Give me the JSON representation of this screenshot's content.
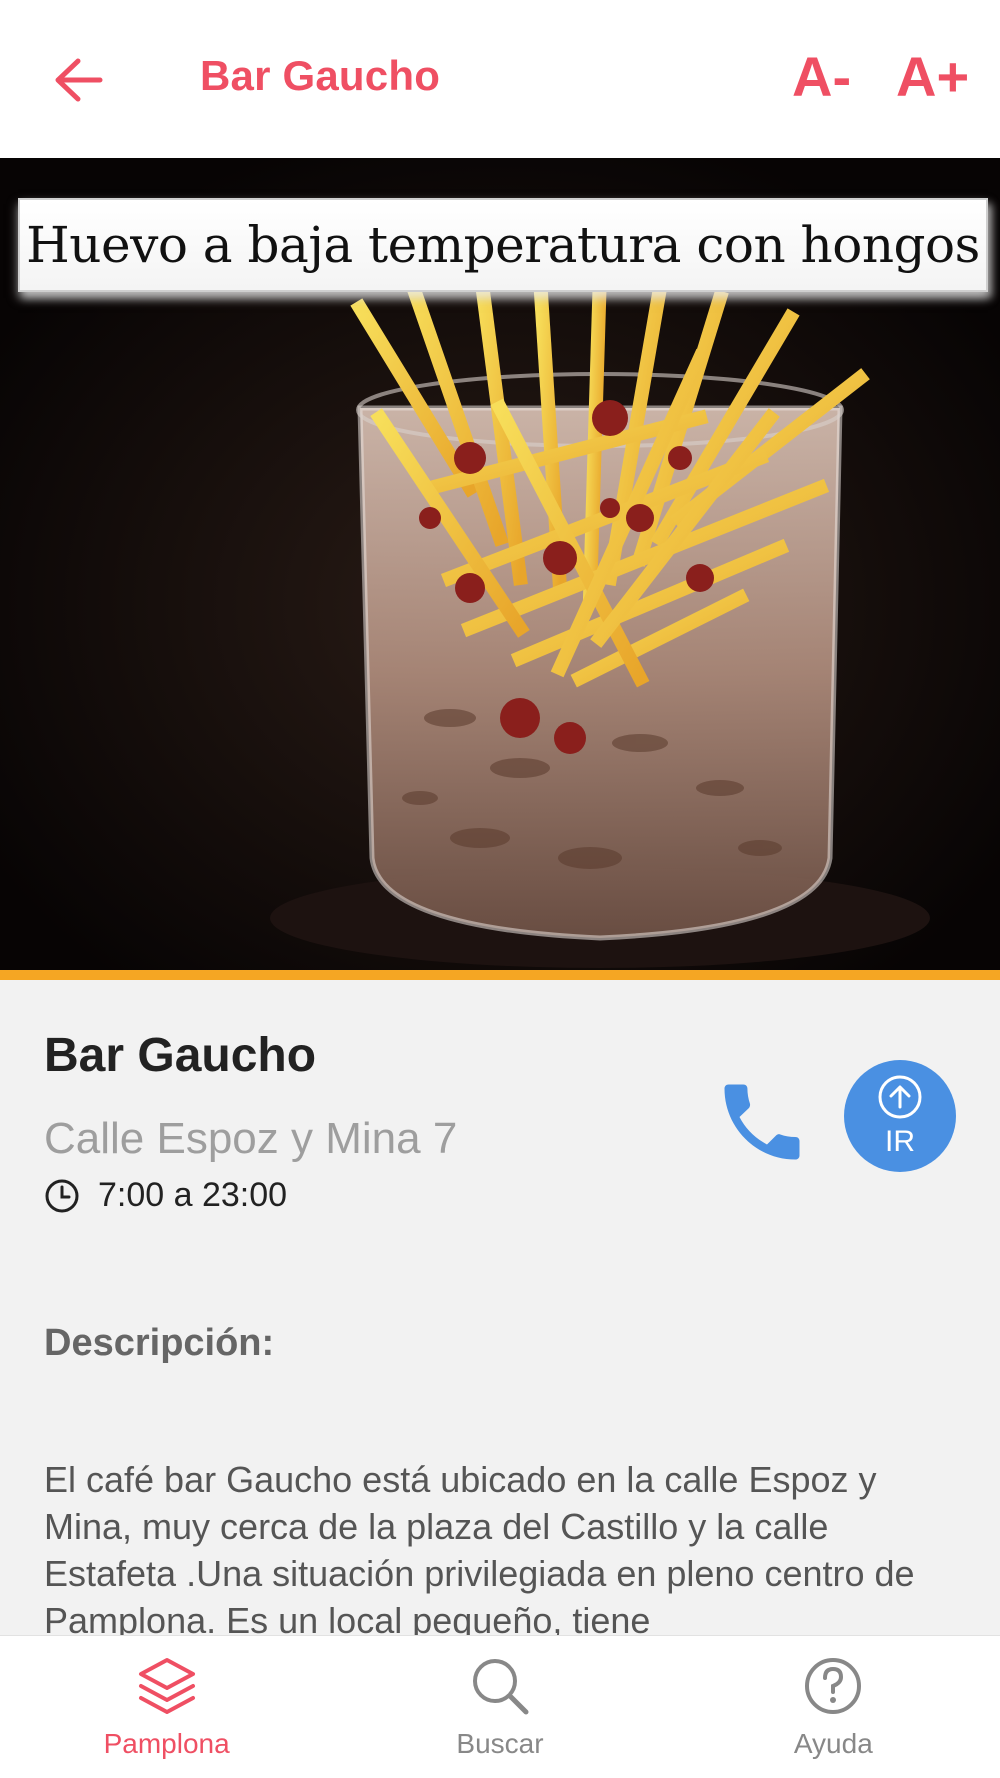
{
  "header": {
    "title": "Bar Gaucho",
    "font_decrease": "A-",
    "font_increase": "A+"
  },
  "hero": {
    "caption": "Huevo a baja temperatura con hongos"
  },
  "place": {
    "name": "Bar Gaucho",
    "address": "Calle Espoz y Mina 7",
    "hours": "7:00 a 23:00",
    "go_label": "IR"
  },
  "description": {
    "title": "Descripción:",
    "text": "El café bar Gaucho está ubicado en la calle Espoz y Mina, muy cerca de la plaza del Castillo y la calle Estafeta .Una situación privilegiada en pleno centro de Pamplona. Es un local pequeño, tiene"
  },
  "nav": {
    "items": [
      {
        "label": "Pamplona",
        "icon": "layers-icon",
        "active": true
      },
      {
        "label": "Buscar",
        "icon": "search-icon",
        "active": false
      },
      {
        "label": "Ayuda",
        "icon": "help-icon",
        "active": false
      }
    ]
  },
  "colors": {
    "accent": "#ef4f63",
    "orange_bar": "#f5a623",
    "action_blue": "#4a90e2"
  }
}
